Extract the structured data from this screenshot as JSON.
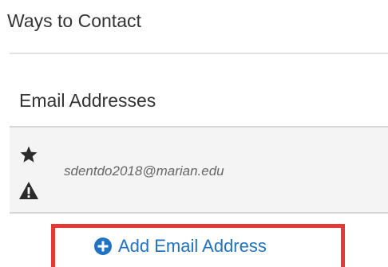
{
  "contact": {
    "title": "Ways to Contact",
    "email_section": {
      "title": "Email Addresses",
      "items": [
        {
          "address": "sdentdo2018@marian.edu",
          "icons": [
            "star-icon",
            "warning-icon"
          ]
        }
      ],
      "add_label": "Add Email Address",
      "add_icon": "plus-circle-icon"
    }
  },
  "colors": {
    "text": "#333333",
    "muted_text": "#666666",
    "link_blue": "#1f72c4",
    "highlight_red": "#e53935",
    "panel_bg": "#f4f4f4"
  }
}
